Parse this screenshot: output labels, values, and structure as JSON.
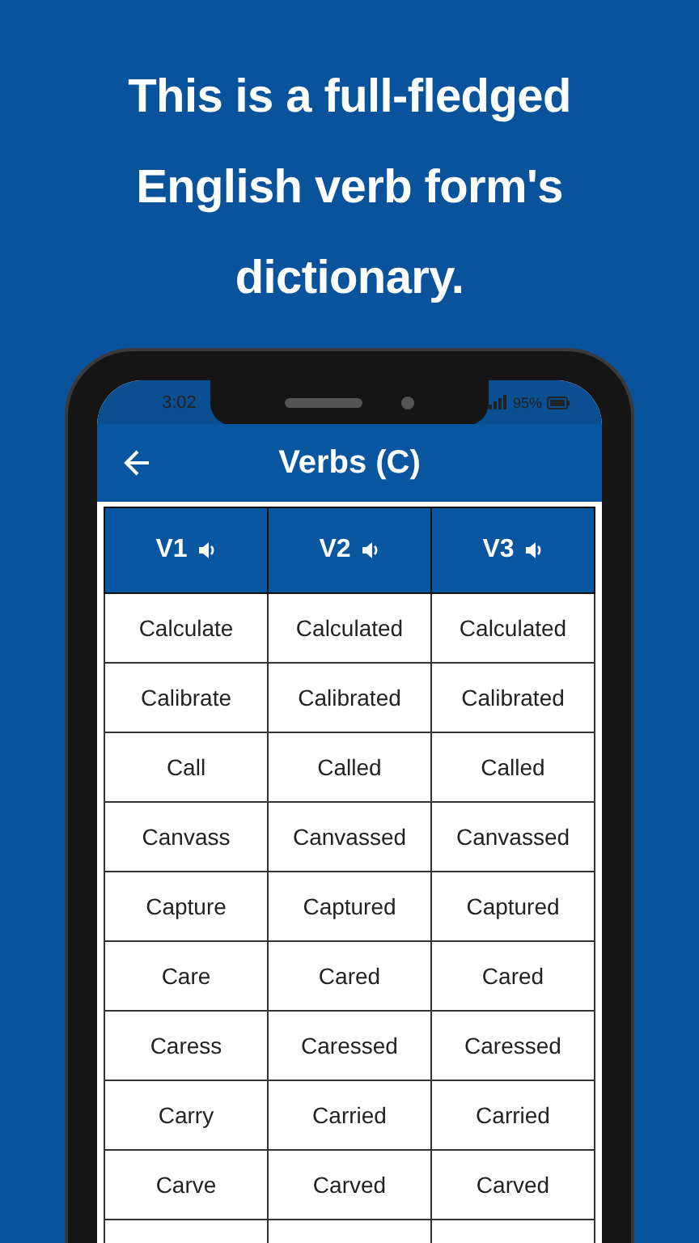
{
  "headline_lines": [
    "This is a full-fledged",
    "English verb form's",
    "dictionary."
  ],
  "status_bar": {
    "time": "3:02",
    "battery": "95%"
  },
  "app_bar": {
    "title": "Verbs (C)"
  },
  "table": {
    "columns": [
      "V1",
      "V2",
      "V3"
    ],
    "rows": [
      [
        "Calculate",
        "Calculated",
        "Calculated"
      ],
      [
        "Calibrate",
        "Calibrated",
        "Calibrated"
      ],
      [
        "Call",
        "Called",
        "Called"
      ],
      [
        "Canvass",
        "Canvassed",
        "Canvassed"
      ],
      [
        "Capture",
        "Captured",
        "Captured"
      ],
      [
        "Care",
        "Cared",
        "Cared"
      ],
      [
        "Caress",
        "Caressed",
        "Caressed"
      ],
      [
        "Carry",
        "Carried",
        "Carried"
      ],
      [
        "Carve",
        "Carved",
        "Carved"
      ]
    ]
  }
}
